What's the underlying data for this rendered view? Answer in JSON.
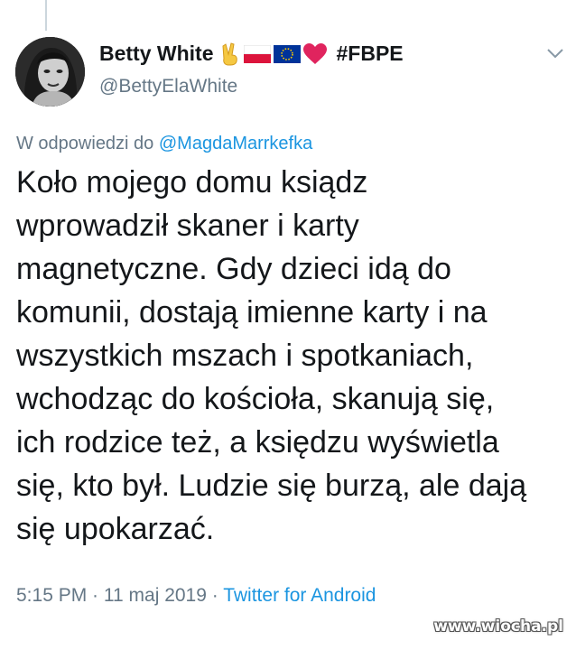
{
  "tweet": {
    "author": {
      "display_name": "Betty White",
      "emojis": [
        "victory-hand-icon",
        "poland-flag-icon",
        "eu-flag-icon",
        "red-heart-icon"
      ],
      "hashtag": "#FBPE",
      "handle": "@BettyElaWhite"
    },
    "reply_prefix": "W odpowiedzi do ",
    "reply_to": "@MagdaMarrkefka",
    "text_lines": [
      "Koło mojego domu ksiądz",
      "wprowadził skaner i karty",
      "magnetyczne. Gdy dzieci idą do",
      "komunii, dostają imienne karty i na",
      "wszystkich mszach i spotkaniach,",
      "wchodząc do kościoła, skanują się,",
      "ich rodzice też, a księdzu wyświetla",
      "się, kto był. Ludzie się burzą, ale dają",
      "się upokarzać."
    ],
    "time": "5:15 PM",
    "separator": " · ",
    "date": "11 maj 2019",
    "source": "Twitter for Android"
  },
  "watermark": "www.wiocha.pl",
  "colors": {
    "text": "#14171a",
    "secondary": "#657786",
    "link": "#1b95e0"
  }
}
